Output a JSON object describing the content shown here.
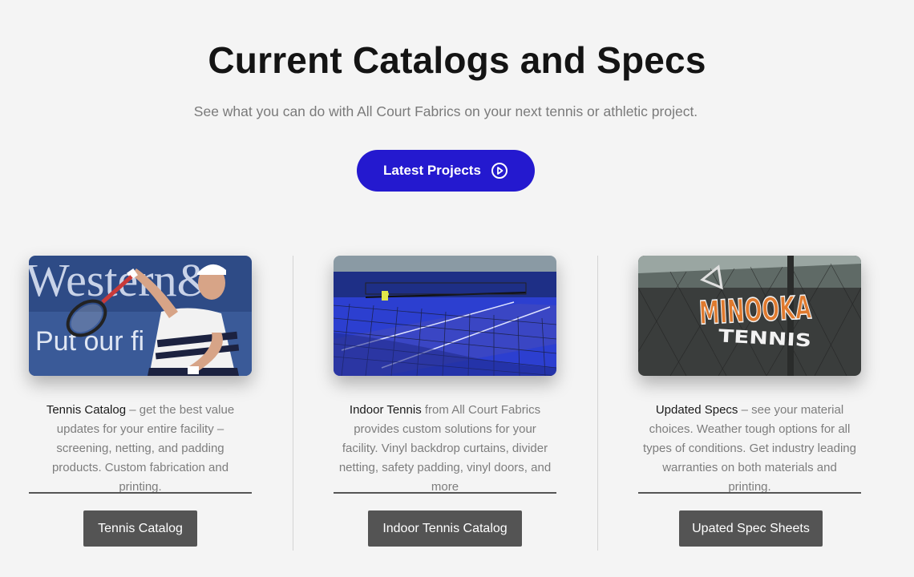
{
  "hero": {
    "title": "Current Catalogs and Specs",
    "subtitle": "See what you can do with All Court Fabrics on your next tennis or athletic project.",
    "cta_label": "Latest Projects",
    "cta_icon": "play-circle-icon",
    "accent_color": "#2419cf"
  },
  "cards": [
    {
      "image_text_1": "Western&",
      "image_text_2": "Put our fi",
      "lead": "Tennis Catalog",
      "body": " – get the best value updates for your entire facility – screening, netting, and padding products. Custom fabrication and printing.",
      "button": "Tennis Catalog"
    },
    {
      "lead": "Indoor Tennis",
      "body": " from All Court Fabrics provides custom solutions for your facility. Vinyl backdrop curtains, divider netting, safety padding, vinyl doors, and more",
      "button": "Indoor Tennis Catalog"
    },
    {
      "image_text_1": "MINOOKA",
      "image_text_2": "TENNIS",
      "lead": "Updated Specs",
      "body": " – see your material choices. Weather tough options for all types of conditions. Get industry leading warranties on both materials and printing.",
      "button": "Upated Spec Sheets"
    }
  ],
  "colors": {
    "button_bg": "#545454",
    "page_bg": "#f4f4f4"
  }
}
